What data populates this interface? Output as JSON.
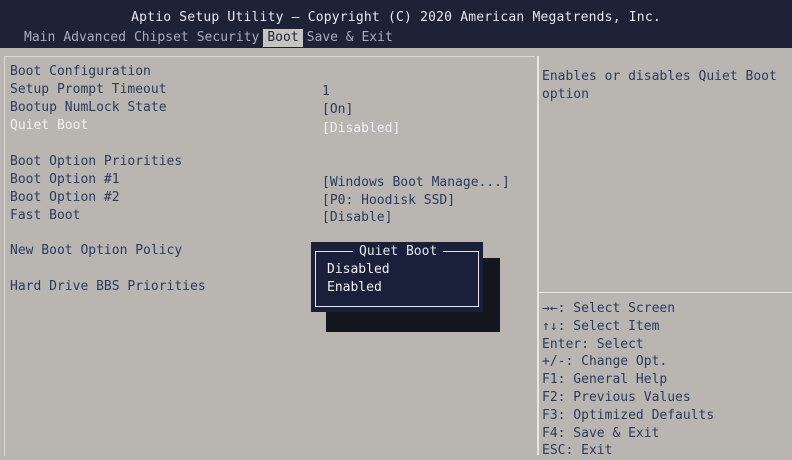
{
  "header": {
    "title": "Aptio Setup Utility – Copyright (C) 2020 American Megatrends, Inc.",
    "tabs": [
      {
        "label": "Main"
      },
      {
        "label": "Advanced"
      },
      {
        "label": "Chipset"
      },
      {
        "label": "Security"
      },
      {
        "label": "Boot"
      },
      {
        "label": "Save & Exit"
      }
    ],
    "active_tab": "Boot"
  },
  "settings": {
    "boot_configuration": "Boot Configuration",
    "setup_prompt_timeout": {
      "label": "Setup Prompt Timeout",
      "value": "1"
    },
    "bootup_numlock": {
      "label": "Bootup NumLock State",
      "value": "[On]"
    },
    "quiet_boot": {
      "label": "Quiet Boot",
      "value": "[Disabled]"
    },
    "boot_option_priorities": "Boot Option Priorities",
    "boot_option_1": {
      "label": "Boot Option #1",
      "value": "[Windows Boot Manage...]"
    },
    "boot_option_2": {
      "label": "Boot Option #2",
      "value": "[P0: Hoodisk SSD]"
    },
    "fast_boot": {
      "label": "Fast Boot",
      "value": "[Disable]"
    },
    "new_boot_option_policy": "New Boot Option Policy",
    "hard_drive_bbs": "Hard Drive BBS Priorities"
  },
  "help": {
    "text": "Enables or disables Quiet Boot option"
  },
  "keys": [
    "→←: Select Screen",
    "↑↓: Select Item",
    "Enter: Select",
    "+/-: Change Opt.",
    "F1: General Help",
    "F2: Previous Values",
    "F3: Optimized Defaults",
    "F4: Save & Exit",
    "ESC: Exit"
  ],
  "popup": {
    "title": "Quiet Boot",
    "options": [
      "Disabled",
      "Enabled"
    ]
  },
  "colors": {
    "background": "#b9b6b1",
    "header": "#1e2236",
    "text": "#2c3a5e",
    "highlight": "#f2f2f6",
    "popup": "#1a1f3a"
  }
}
